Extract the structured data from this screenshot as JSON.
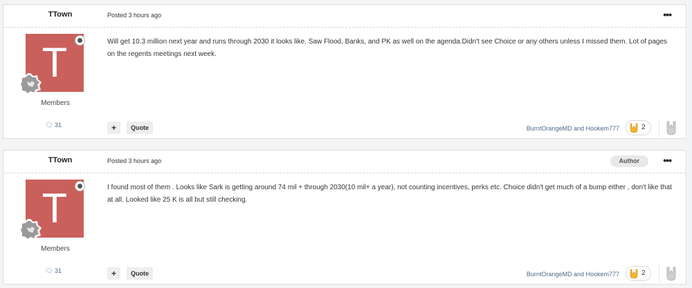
{
  "posts": [
    {
      "username": "TTown",
      "posted_label": "Posted",
      "posted_time": "3 hours ago",
      "author_badge": "",
      "avatar_letter": "T",
      "group": "Members",
      "post_count": "31",
      "content": "Will get 10.3 million  next year and runs through 2030 it looks like. Saw Flood, Banks, and PK as well on the agenda.Didn't see Choice or any others  unless I missed them. Lot of pages on the regents meetings next week.",
      "plus_label": "+",
      "quote_label": "Quote",
      "reactors": "BurntOrangeMD and Hookem777",
      "reaction_count": "2"
    },
    {
      "username": "TTown",
      "posted_label": "Posted",
      "posted_time": "3 hours ago",
      "author_badge": "Author",
      "avatar_letter": "T",
      "group": "Members",
      "post_count": "31",
      "content": "I found most  of them . Looks like Sark is getting around 74 mil + through 2030(10 mil+ a year), not counting incentives, perks etc. Choice didn't get much of a bump either , don't like that at all. Looked like 25 K is all but still checking.",
      "plus_label": "+",
      "quote_label": "Quote",
      "reactors": "BurntOrangeMD and Hookem777",
      "reaction_count": "2"
    }
  ],
  "icons": {
    "more": "ellipsis-icon",
    "comment": "comment-icon",
    "rank": "rank-badge-icon",
    "reaction": "horns-hand-icon"
  },
  "colors": {
    "avatar": "#c9605b",
    "link": "#4b6a8a",
    "reaction_yellow": "#f2b630"
  }
}
